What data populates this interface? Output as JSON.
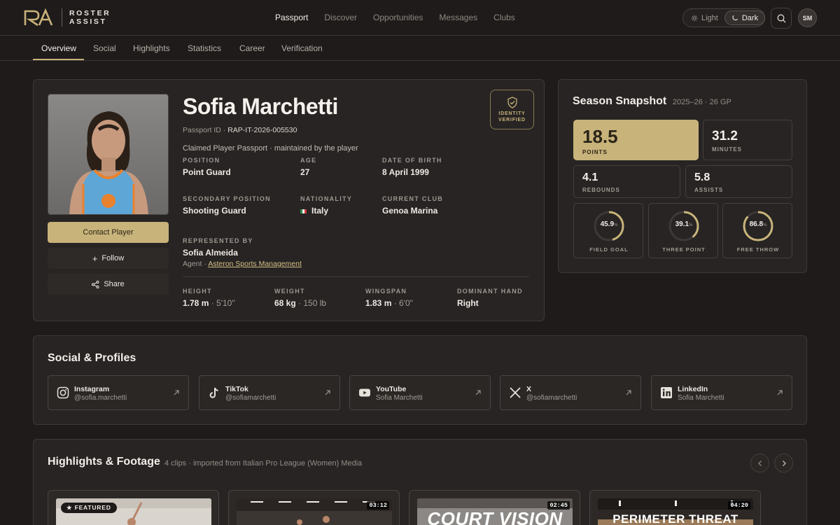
{
  "brand": {
    "line1": "ROSTER",
    "line2": "ASSIST"
  },
  "nav": {
    "items": [
      "Passport",
      "Discover",
      "Opportunities",
      "Messages",
      "Clubs"
    ],
    "active": "Passport"
  },
  "theme": {
    "light": "Light",
    "dark": "Dark",
    "active": "Dark"
  },
  "user": {
    "initials": "SM"
  },
  "tabs": [
    "Overview",
    "Social",
    "Highlights",
    "Statistics",
    "Career",
    "Verification"
  ],
  "active_tab": "Overview",
  "profile": {
    "name": "Sofia Marchetti",
    "passport_label": "Passport ID ·",
    "passport_id": "RAP-IT-2026-005530",
    "claimed": "Claimed Player Passport · maintained by the player",
    "badge_line1": "IDENTITY",
    "badge_line2": "VERIFIED",
    "contact_label": "Contact Player",
    "follow_label": "Follow",
    "share_label": "Share",
    "fields": {
      "position": {
        "label": "POSITION",
        "value": "Point Guard"
      },
      "age": {
        "label": "AGE",
        "value": "27"
      },
      "dob": {
        "label": "DATE OF BIRTH",
        "value": "8 April 1999"
      },
      "secondary": {
        "label": "SECONDARY POSITION",
        "value": "Shooting Guard"
      },
      "nationality": {
        "label": "NATIONALITY",
        "value": "Italy"
      },
      "club": {
        "label": "CURRENT CLUB",
        "value": "Genoa Marina"
      },
      "represented": {
        "label": "REPRESENTED BY",
        "value": "Sofia Almeida",
        "role": "Agent ·",
        "agency": "Asteron Sports Management"
      }
    },
    "physical": {
      "height": {
        "label": "HEIGHT",
        "value": "1.78 m",
        "alt": "· 5'10\""
      },
      "weight": {
        "label": "WEIGHT",
        "value": "68 kg",
        "alt": "· 150 lb"
      },
      "wingspan": {
        "label": "WINGSPAN",
        "value": "1.83 m",
        "alt": "· 6'0\""
      },
      "hand": {
        "label": "DOMINANT HAND",
        "value": "Right"
      }
    }
  },
  "snapshot": {
    "title": "Season Snapshot",
    "subtitle": "2025–26 · 26 GP",
    "points": {
      "value": "18.5",
      "label": "POINTS"
    },
    "minutes": {
      "value": "31.2",
      "label": "MINUTES"
    },
    "rebounds": {
      "value": "4.1",
      "label": "REBOUNDS"
    },
    "assists": {
      "value": "5.8",
      "label": "ASSISTS"
    },
    "rings": [
      {
        "value": "45.9",
        "pct": 45.9,
        "label": "FIELD GOAL"
      },
      {
        "value": "39.1",
        "pct": 39.1,
        "label": "THREE POINT"
      },
      {
        "value": "86.8",
        "pct": 86.8,
        "label": "FREE THROW"
      }
    ],
    "pct_unit": "%"
  },
  "social": {
    "title": "Social & Profiles",
    "items": [
      {
        "name": "Instagram",
        "handle": "@sofia.marchetti",
        "icon": "instagram-icon"
      },
      {
        "name": "TikTok",
        "handle": "@sofiamarchetti",
        "icon": "tiktok-icon"
      },
      {
        "name": "YouTube",
        "handle": "Sofia Marchetti",
        "icon": "youtube-icon"
      },
      {
        "name": "X",
        "handle": "@sofiamarchetti",
        "icon": "x-icon"
      },
      {
        "name": "LinkedIn",
        "handle": "Sofia Marchetti",
        "icon": "linkedin-icon"
      }
    ]
  },
  "highlights": {
    "title": "Highlights & Footage",
    "subtitle": "4 clips · imported from Italian Pro League (Women) Media",
    "featured_label": "FEATURED",
    "clips": [
      {
        "duration": "",
        "title": ""
      },
      {
        "duration": "03:12",
        "title": ""
      },
      {
        "duration": "02:45",
        "title": "COURT VISION"
      },
      {
        "duration": "04:20",
        "title": "PERIMETER THREAT"
      }
    ]
  },
  "colors": {
    "accent": "#c8b37a",
    "background": "#1e1b1a",
    "card": "#272423"
  }
}
